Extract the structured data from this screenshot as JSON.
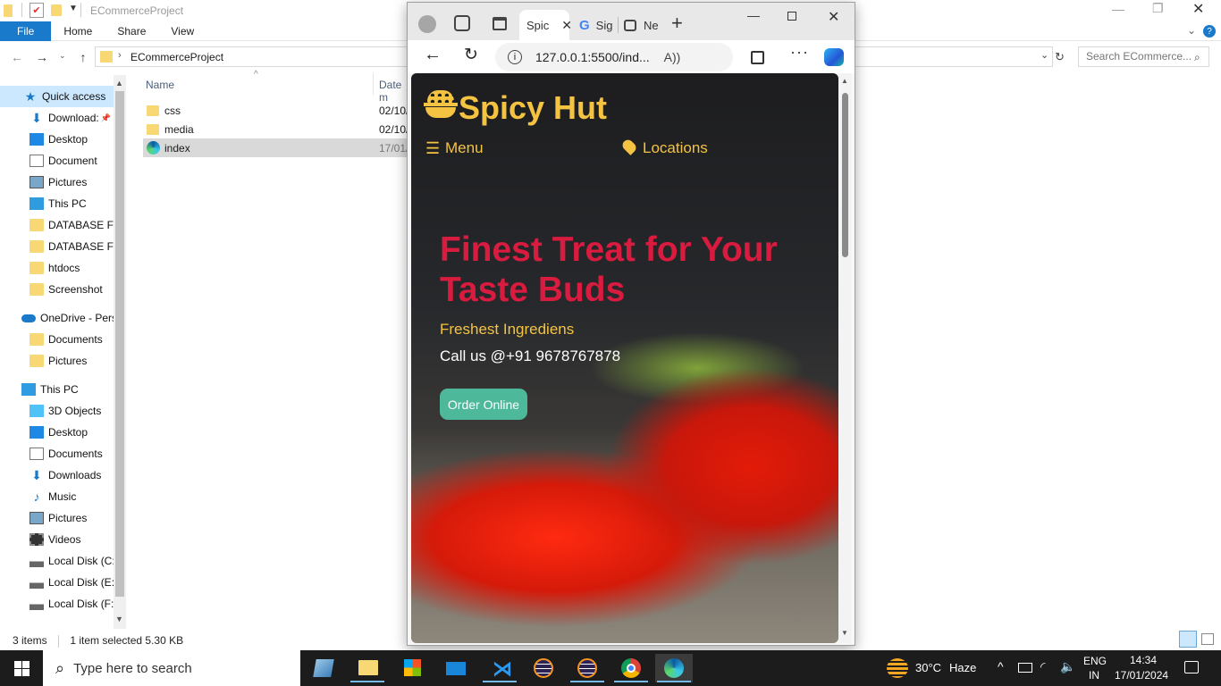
{
  "explorer": {
    "window_title": "ECommerceProject",
    "ribbon_tabs": [
      "File",
      "Home",
      "Share",
      "View"
    ],
    "address_path": "ECommerceProject",
    "search_placeholder": "Search ECommerce...",
    "nav_items": [
      {
        "label": "Quick access",
        "icon": "star-icon"
      },
      {
        "label": "Download:",
        "icon": "download-icon"
      },
      {
        "label": "Desktop",
        "icon": "desktop-icon"
      },
      {
        "label": "Document",
        "icon": "document-icon"
      },
      {
        "label": "Pictures",
        "icon": "pictures-icon"
      },
      {
        "label": "This PC",
        "icon": "pc-icon"
      },
      {
        "label": "DATABASE FIL",
        "icon": "folder-icon"
      },
      {
        "label": "DATABASE FIL",
        "icon": "folder-icon"
      },
      {
        "label": "htdocs",
        "icon": "folder-icon"
      },
      {
        "label": "Screenshot",
        "icon": "folder-icon"
      },
      {
        "label": "OneDrive - Pers",
        "icon": "cloud-icon"
      },
      {
        "label": "Documents",
        "icon": "folder-icon"
      },
      {
        "label": "Pictures",
        "icon": "folder-icon"
      },
      {
        "label": "This PC",
        "icon": "pc-icon"
      },
      {
        "label": "3D Objects",
        "icon": "cube-icon"
      },
      {
        "label": "Desktop",
        "icon": "desktop-icon"
      },
      {
        "label": "Documents",
        "icon": "document-icon"
      },
      {
        "label": "Downloads",
        "icon": "download-icon"
      },
      {
        "label": "Music",
        "icon": "music-icon"
      },
      {
        "label": "Pictures",
        "icon": "pictures-icon"
      },
      {
        "label": "Videos",
        "icon": "video-icon"
      },
      {
        "label": "Local Disk (C:",
        "icon": "disk-icon"
      },
      {
        "label": "Local Disk (E:)",
        "icon": "disk-icon"
      },
      {
        "label": "Local Disk (F:)",
        "icon": "disk-icon"
      }
    ],
    "columns": {
      "name": "Name",
      "date": "Date m"
    },
    "files": [
      {
        "name": "css",
        "date": "02/10/",
        "icon": "folder-icon"
      },
      {
        "name": "media",
        "date": "02/10/",
        "icon": "folder-icon"
      },
      {
        "name": "index",
        "date": "17/01/",
        "icon": "edge-icon",
        "selected": true
      }
    ],
    "status": {
      "count": "3 items",
      "selection": "1 item selected  5.30 KB"
    }
  },
  "browser": {
    "tabs": [
      {
        "label": "Spic",
        "active": true
      },
      {
        "label": "Sig"
      },
      {
        "label": "Ne"
      }
    ],
    "url": "127.0.0.1:5500/ind...",
    "site": {
      "brand": "Spicy Hut",
      "nav_menu": "Menu",
      "nav_locations": "Locations",
      "hero_title": "Finest Treat for Your Taste Buds",
      "hero_sub": "Freshest Ingrediens",
      "hero_phone": "Call us @+91 9678767878",
      "cta": "Order Online",
      "colors": {
        "brand": "#f5c342",
        "title": "#d81b3f",
        "cta": "#4db89a"
      }
    }
  },
  "taskbar": {
    "search_placeholder": "Type here to search",
    "weather_temp": "30°C",
    "weather_text": "Haze",
    "lang_top": "ENG",
    "lang_bottom": "IN",
    "time": "14:34",
    "date": "17/01/2024"
  }
}
